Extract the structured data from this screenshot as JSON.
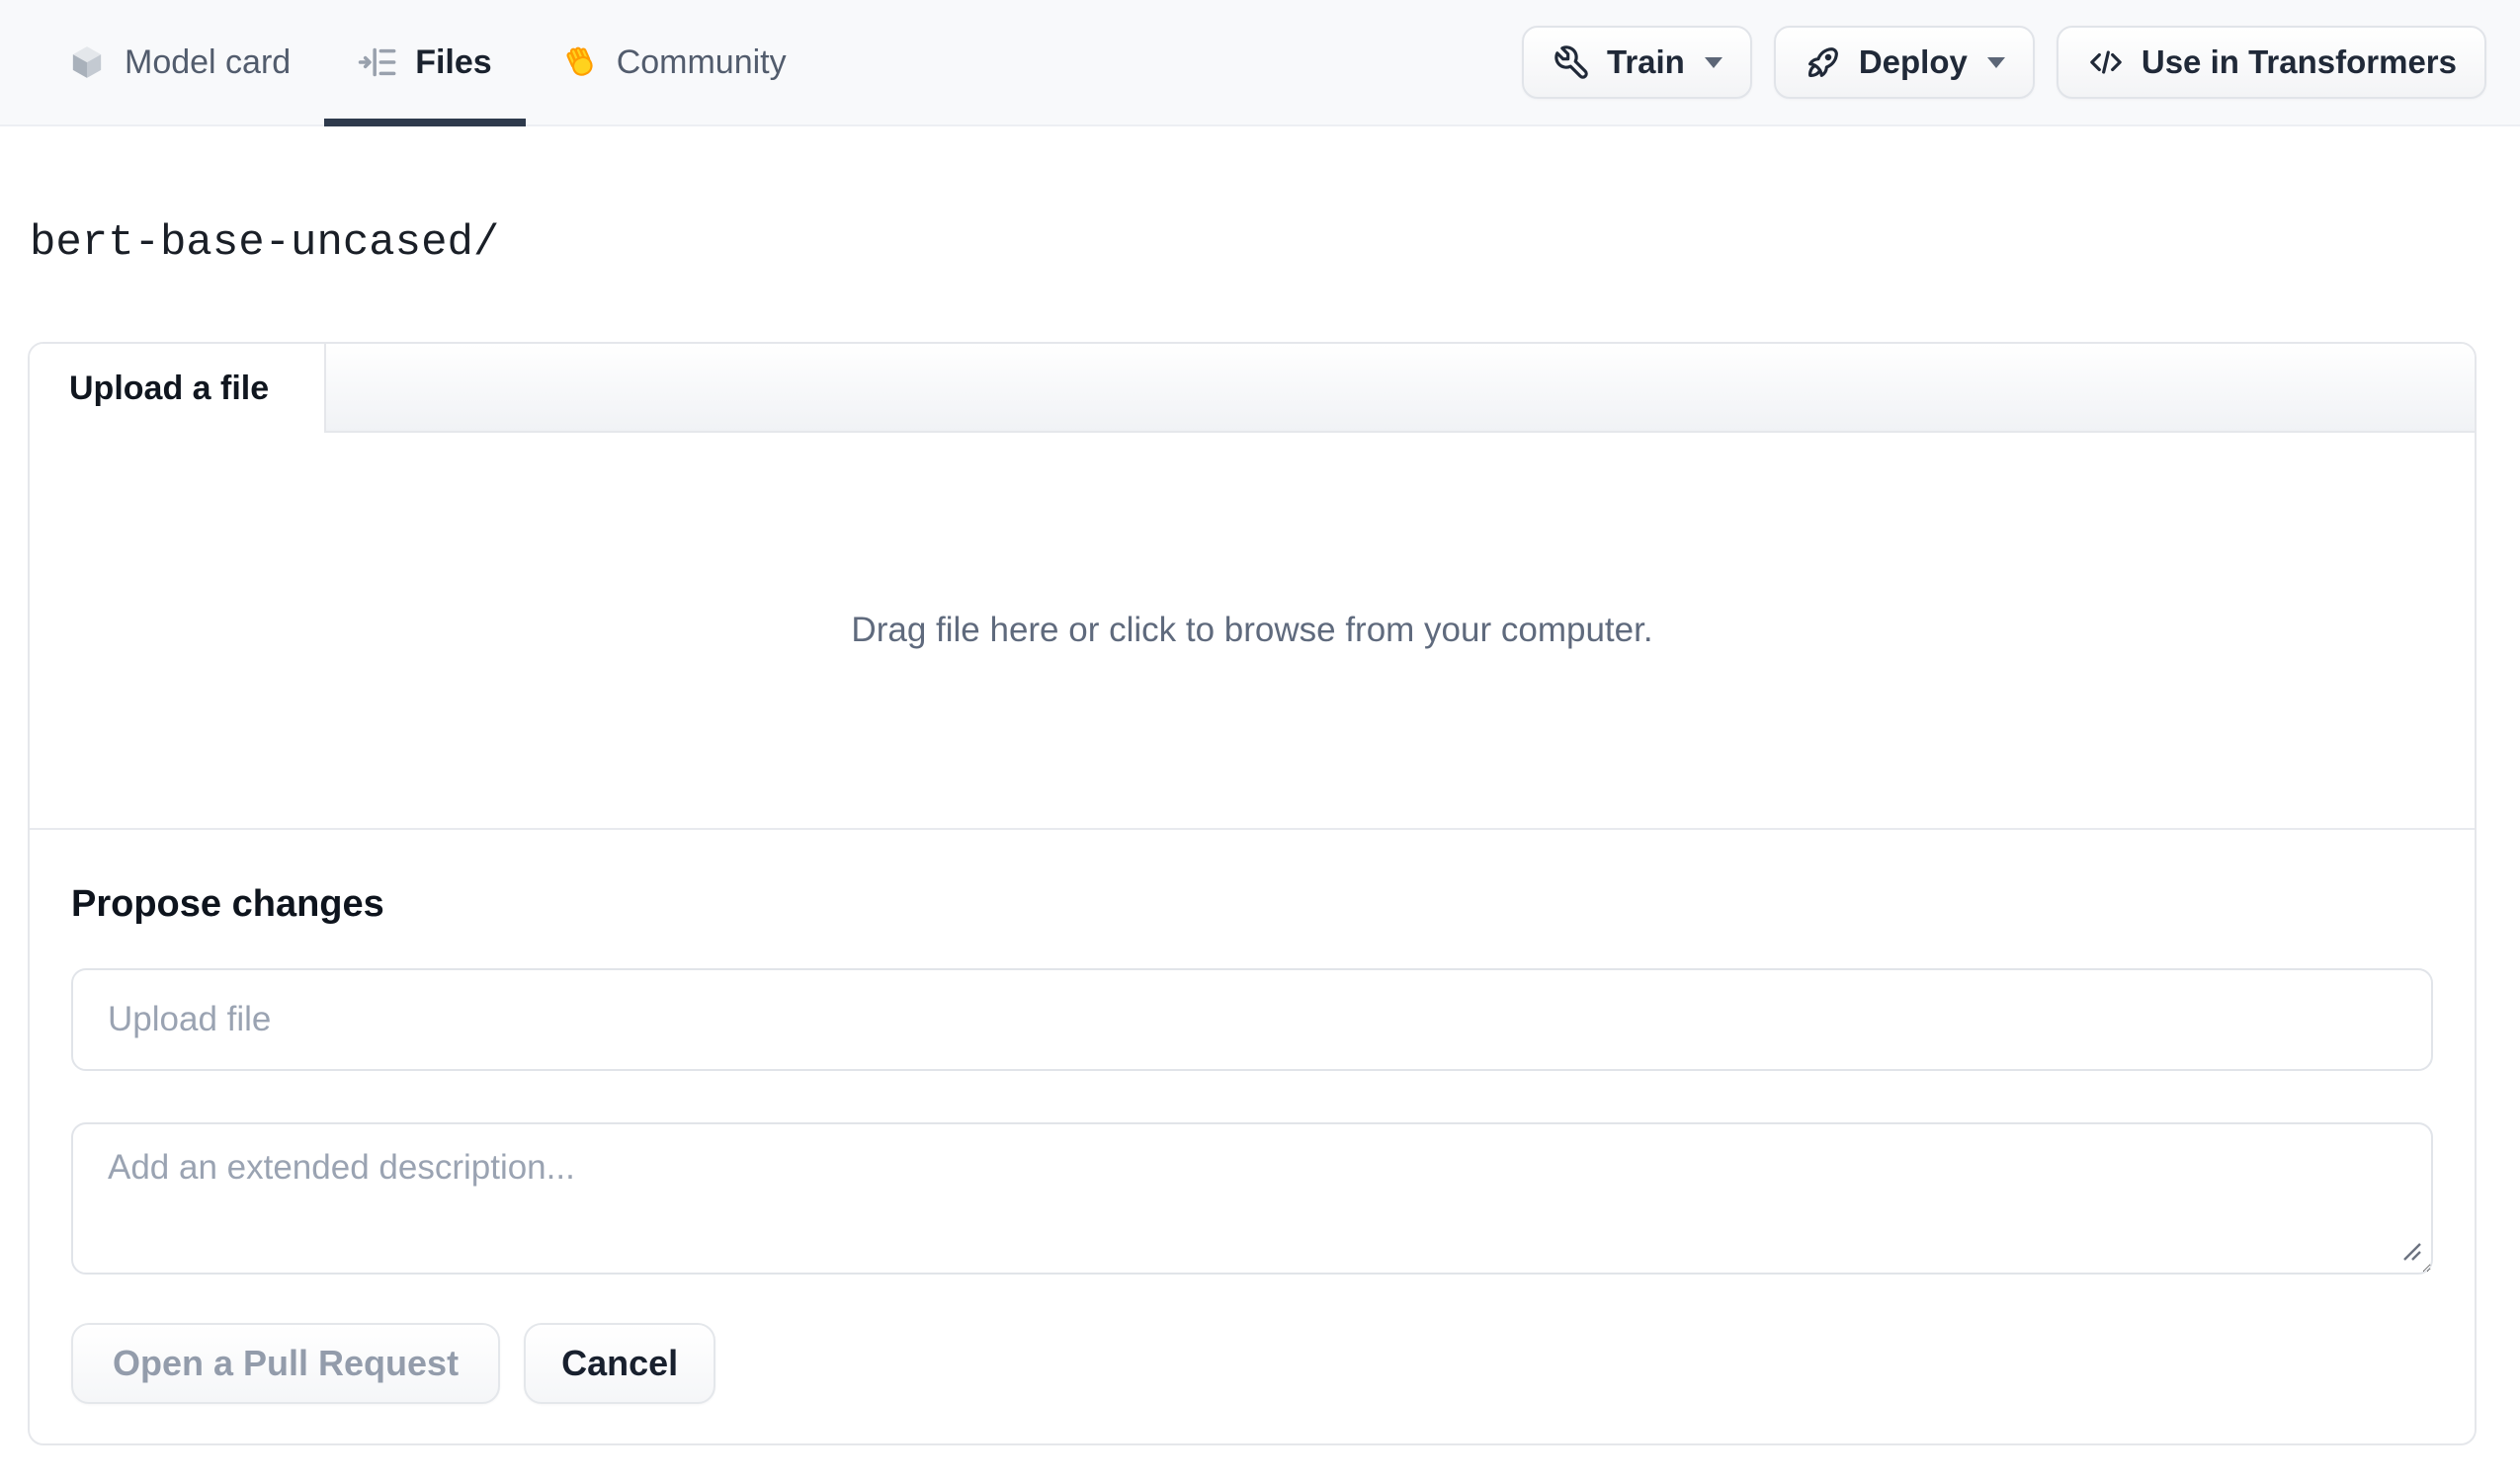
{
  "header": {
    "tabs": [
      {
        "label": "Model card",
        "icon": "cube-icon",
        "active": false
      },
      {
        "label": "Files",
        "icon": "files-list-icon",
        "active": true
      },
      {
        "label": "Community",
        "icon": "waving-hand-icon",
        "active": false
      }
    ],
    "actions": [
      {
        "label": "Train",
        "icon": "wrench-icon",
        "has_dropdown": true
      },
      {
        "label": "Deploy",
        "icon": "rocket-icon",
        "has_dropdown": true
      },
      {
        "label": "Use in Transformers",
        "icon": "code-icon",
        "has_dropdown": false
      }
    ]
  },
  "path": {
    "current_dir": "bert-base-uncased/"
  },
  "upload_panel": {
    "tab_label": "Upload a file",
    "dropzone_text": "Drag file here or click to browse from your computer.",
    "propose_heading": "Propose changes",
    "filename_input": {
      "value": "",
      "placeholder": "Upload file"
    },
    "description_input": {
      "value": "",
      "placeholder": "Add an extended description..."
    },
    "buttons": {
      "primary": "Open a Pull Request",
      "primary_disabled": true,
      "secondary": "Cancel"
    }
  },
  "colors": {
    "topbar_bg": "#f8f9fb",
    "active_tab_underline": "#2e3a4c",
    "hand_yellow": "#ffd21e",
    "hand_orange": "#ff9d00",
    "muted_text": "#5f6a7d",
    "placeholder_text": "#9aa3b2",
    "border": "#e5e7eb"
  }
}
